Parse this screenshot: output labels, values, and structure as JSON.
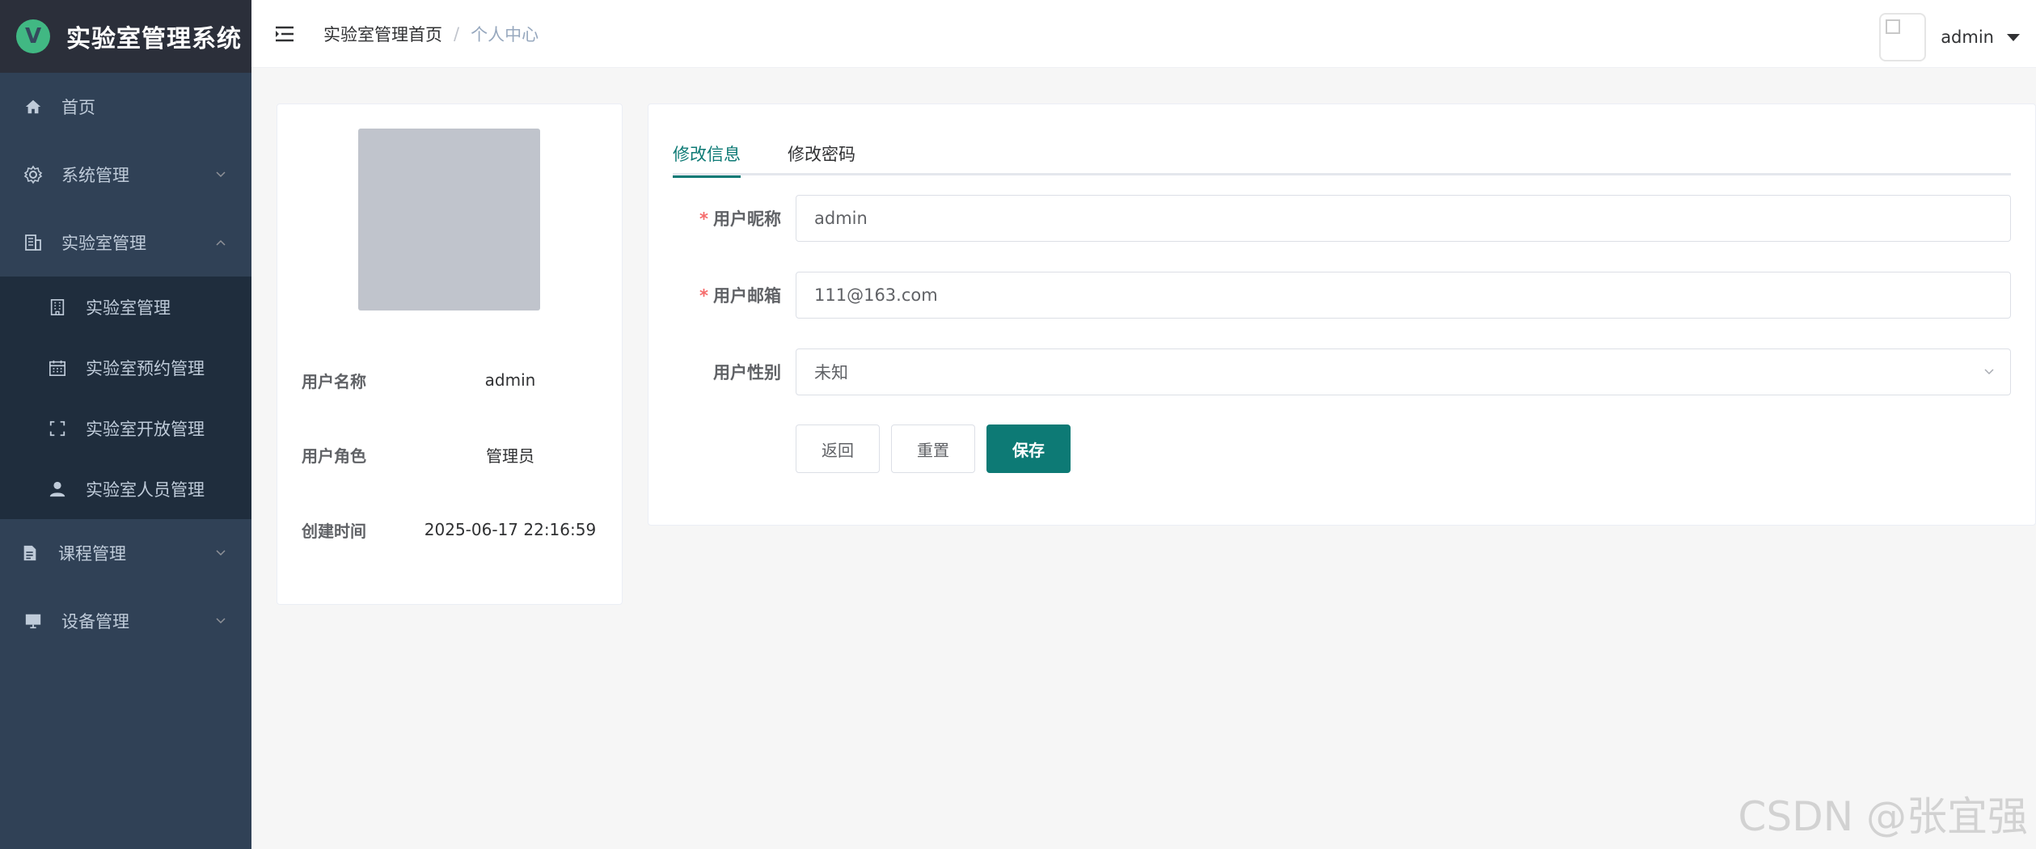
{
  "sidebar": {
    "title": "实验室管理系统",
    "logo_letter": "V",
    "items": [
      {
        "label": "首页",
        "icon": "home-icon"
      },
      {
        "label": "系统管理",
        "icon": "gear-icon"
      },
      {
        "label": "实验室管理",
        "icon": "building-icon",
        "expanded": true
      },
      {
        "label": "课程管理",
        "icon": "document-icon"
      },
      {
        "label": "设备管理",
        "icon": "monitor-icon"
      }
    ],
    "submenu": [
      {
        "label": "实验室管理",
        "icon": "office-building-icon"
      },
      {
        "label": "实验室预约管理",
        "icon": "calendar-icon"
      },
      {
        "label": "实验室开放管理",
        "icon": "fullscreen-icon"
      },
      {
        "label": "实验室人员管理",
        "icon": "user-icon"
      }
    ]
  },
  "header": {
    "breadcrumb_home": "实验室管理首页",
    "breadcrumb_separator": "/",
    "breadcrumb_current": "个人中心",
    "username": "admin"
  },
  "profile": {
    "rows": [
      {
        "label": "用户名称",
        "value": "admin"
      },
      {
        "label": "用户角色",
        "value": "管理员"
      },
      {
        "label": "创建时间",
        "value": "2025-06-17 22:16:59"
      }
    ]
  },
  "form": {
    "tabs": [
      {
        "label": "修改信息",
        "active": true
      },
      {
        "label": "修改密码",
        "active": false
      }
    ],
    "nickname_label": "用户昵称",
    "nickname_value": "admin",
    "email_label": "用户邮箱",
    "email_value": "111@163.com",
    "gender_label": "用户性别",
    "gender_value": "未知",
    "required_mark": "*",
    "back_button": "返回",
    "reset_button": "重置",
    "save_button": "保存"
  },
  "watermark": "CSDN @张宜强",
  "colors": {
    "sidebar_bg": "#304156",
    "submenu_bg": "#1f2d3d",
    "accent": "#0d7a75",
    "required": "#f56c6c"
  }
}
